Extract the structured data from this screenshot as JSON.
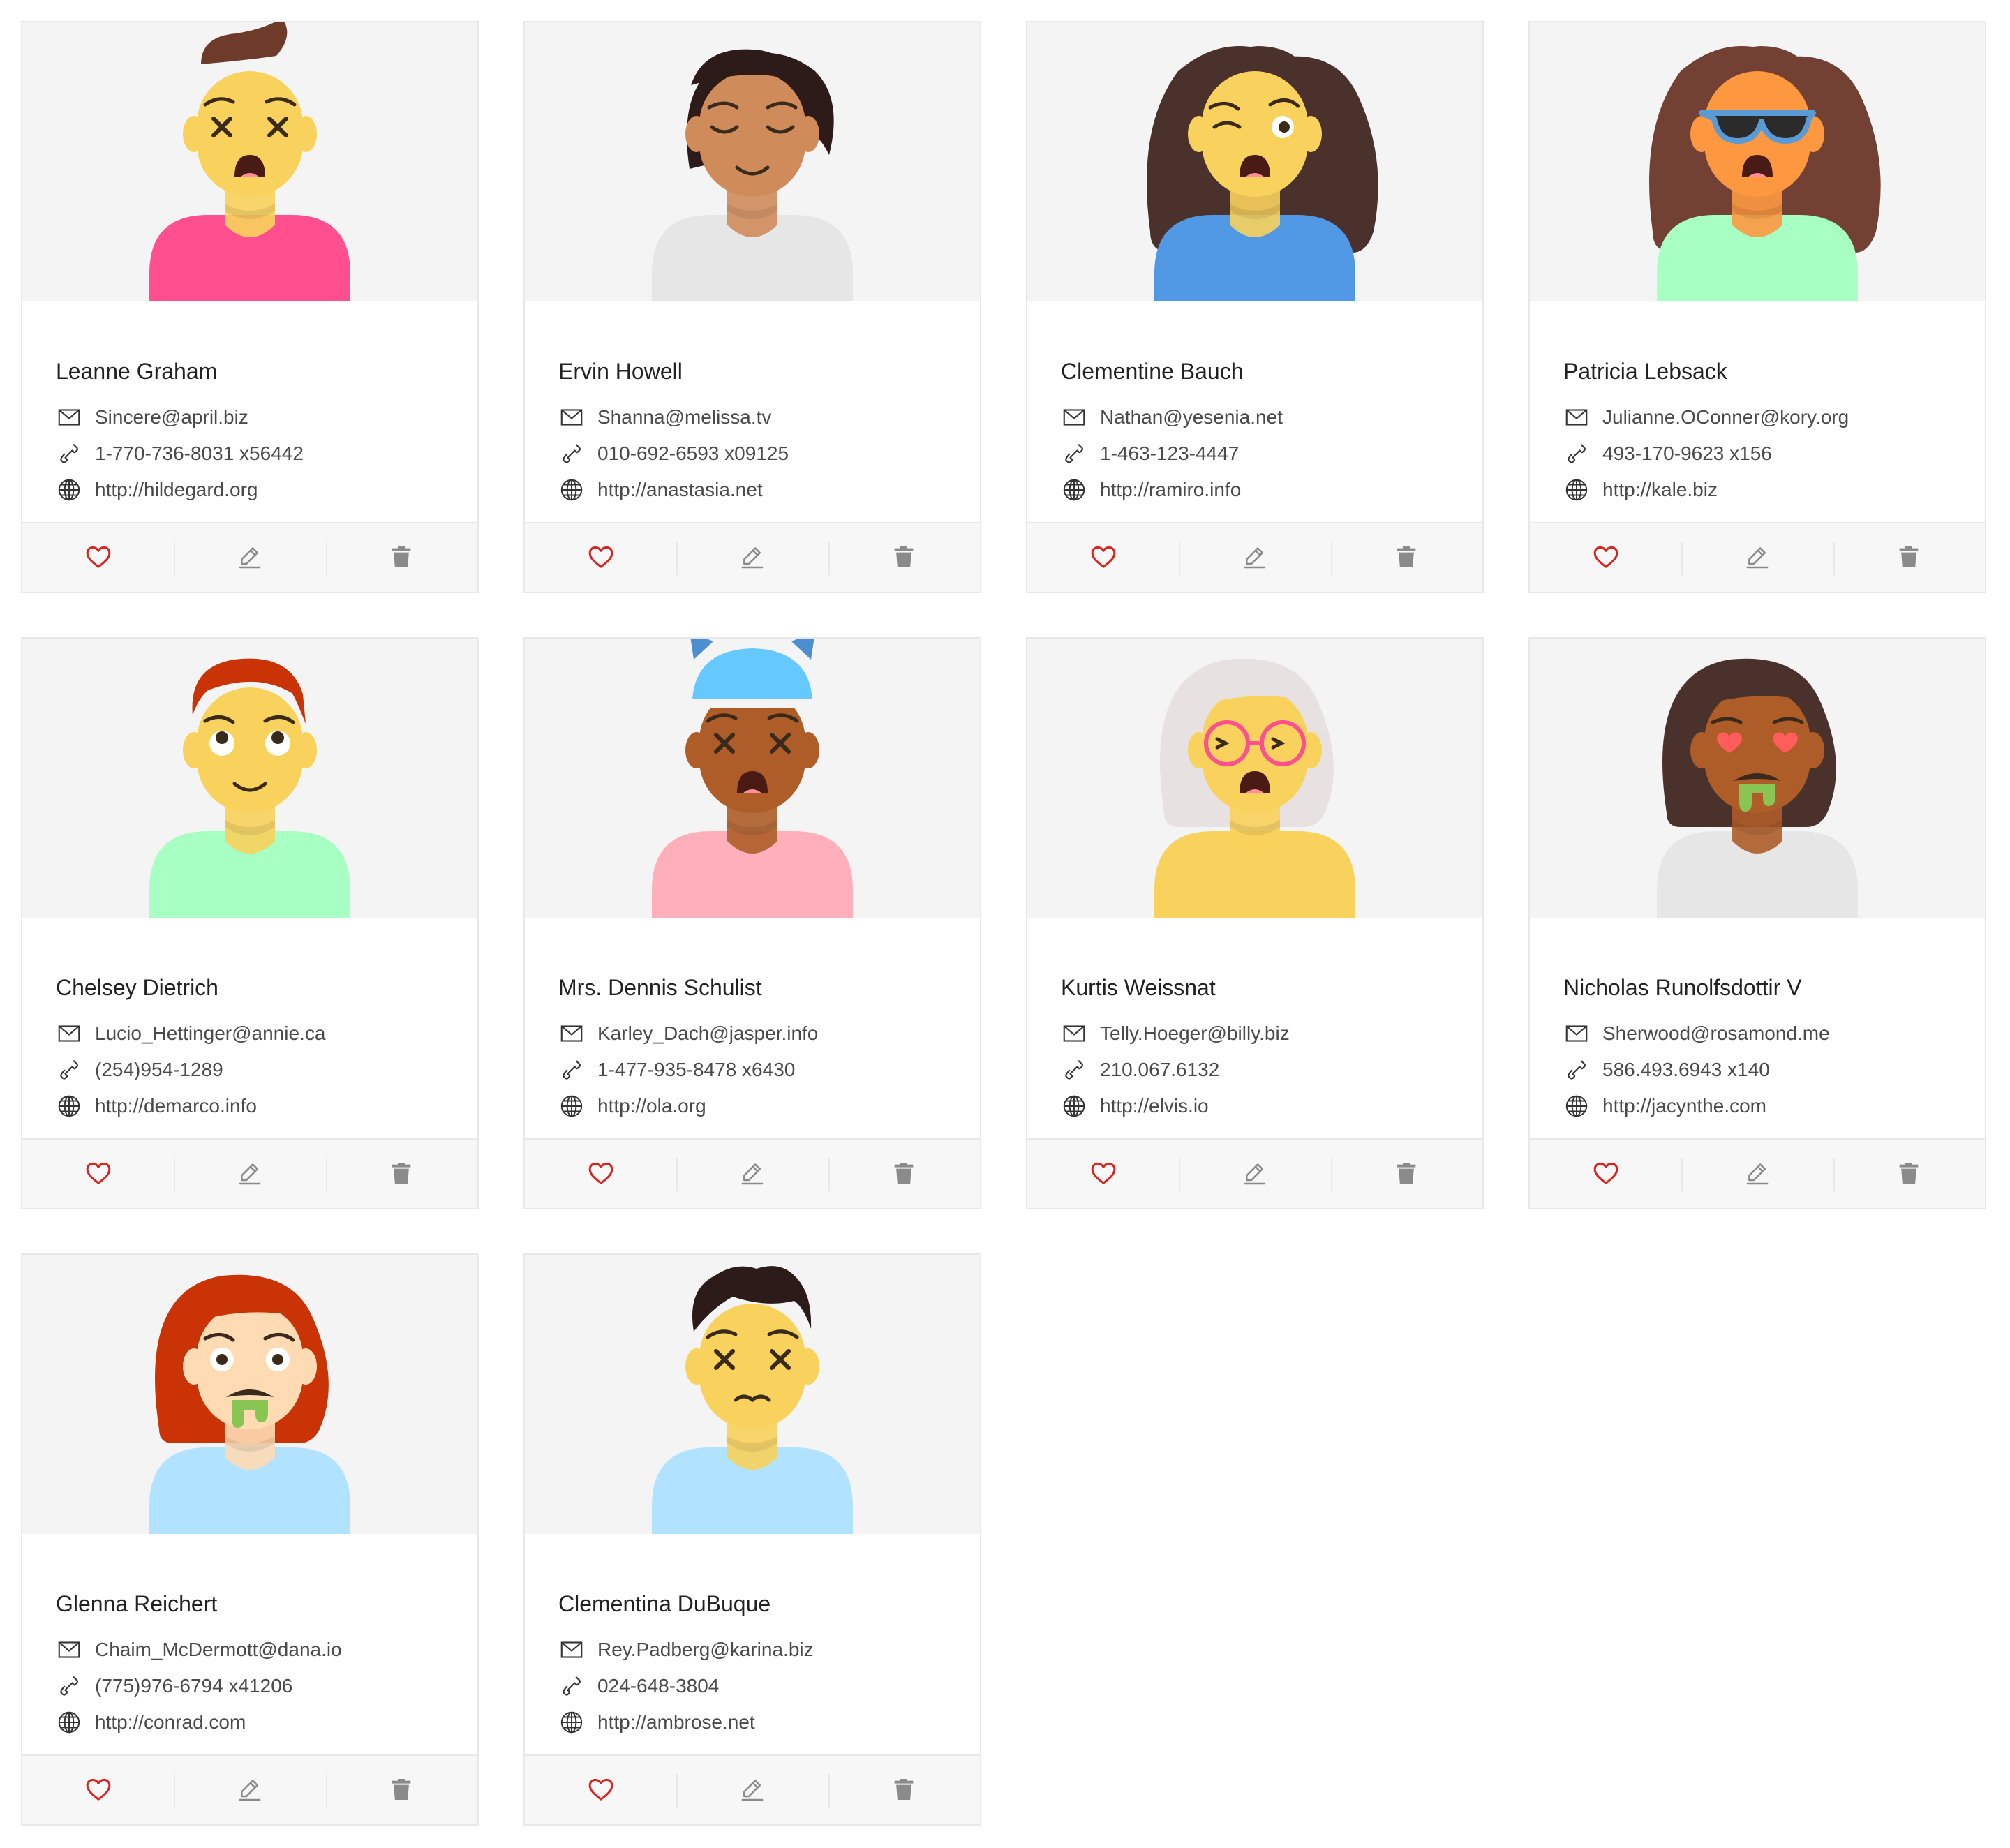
{
  "colors": {
    "heart": "#e0201b",
    "action_icon": "#8a8a8a",
    "text": "#4a4a4a",
    "avatar_bg": "#f4f4f4"
  },
  "icons": {
    "email": "mail-icon",
    "phone": "phone-icon",
    "website": "globe-icon",
    "like": "heart-icon",
    "edit": "pencil-icon",
    "delete": "trash-icon"
  },
  "users": [
    {
      "name": "Leanne Graham",
      "email": "Sincere@april.biz",
      "phone": "1-770-736-8031 x56442",
      "website": "http://hildegard.org",
      "avatar": {
        "skin": "#f8d25c",
        "hair": "#6e3b2b",
        "hair_style": "quiff",
        "shirt": "#ff4f8f",
        "eyes": "crossed",
        "mouth": "open"
      }
    },
    {
      "name": "Ervin Howell",
      "email": "Shanna@melissa.tv",
      "phone": "010-692-6593 x09125",
      "website": "http://anastasia.net",
      "avatar": {
        "skin": "#d08b5b",
        "hair": "#2c1b18",
        "hair_style": "bob",
        "shirt": "#e6e6e6",
        "eyes": "closed",
        "mouth": "smile"
      }
    },
    {
      "name": "Clementine Bauch",
      "email": "Nathan@yesenia.net",
      "phone": "1-463-123-4447",
      "website": "http://ramiro.info",
      "avatar": {
        "skin": "#f8d25c",
        "hair": "#4a312c",
        "hair_style": "long",
        "shirt": "#5199e4",
        "eyes": "wink",
        "mouth": "open"
      }
    },
    {
      "name": "Patricia Lebsack",
      "email": "Julianne.OConner@kory.org",
      "phone": "493-170-9623 x156",
      "website": "http://kale.biz",
      "avatar": {
        "skin": "#fd9841",
        "hair": "#724133",
        "hair_style": "long",
        "shirt": "#a7ffc4",
        "eyes": "sunglasses",
        "mouth": "open"
      }
    },
    {
      "name": "Chelsey Dietrich",
      "email": "Lucio_Hettinger@annie.ca",
      "phone": "(254)954-1289",
      "website": "http://demarco.info",
      "avatar": {
        "skin": "#f8d25c",
        "hair": "#c93305",
        "hair_style": "short",
        "shirt": "#a7ffc4",
        "eyes": "roll",
        "mouth": "smile"
      }
    },
    {
      "name": "Mrs. Dennis Schulist",
      "email": "Karley_Dach@jasper.info",
      "phone": "1-477-935-8478 x6430",
      "website": "http://ola.org",
      "avatar": {
        "skin": "#ae5d29",
        "hair": "#65c9ff",
        "hair_style": "cathat",
        "shirt": "#ffafb9",
        "eyes": "crossed",
        "mouth": "open"
      }
    },
    {
      "name": "Kurtis Weissnat",
      "email": "Telly.Hoeger@billy.biz",
      "phone": "210.067.6132",
      "website": "http://elvis.io",
      "avatar": {
        "skin": "#f8d25c",
        "hair": "#e8e1e1",
        "hair_style": "bob-long",
        "shirt": "#f8d25c",
        "eyes": "squint-glasses",
        "mouth": "open"
      }
    },
    {
      "name": "Nicholas Runolfsdottir V",
      "email": "Sherwood@rosamond.me",
      "phone": "586.493.6943 x140",
      "website": "http://jacynthe.com",
      "avatar": {
        "skin": "#ae5d29",
        "hair": "#4a312c",
        "hair_style": "bob-long",
        "shirt": "#e6e6e6",
        "eyes": "hearts",
        "mouth": "vomit"
      }
    },
    {
      "name": "Glenna Reichert",
      "email": "Chaim_McDermott@dana.io",
      "phone": "(775)976-6794 x41206",
      "website": "http://conrad.com",
      "avatar": {
        "skin": "#ffdbb4",
        "hair": "#c93305",
        "hair_style": "bob-long",
        "shirt": "#b1e2ff",
        "eyes": "round",
        "mouth": "vomit"
      }
    },
    {
      "name": "Clementina DuBuque",
      "email": "Rey.Padberg@karina.biz",
      "phone": "024-648-3804",
      "website": "http://ambrose.net",
      "avatar": {
        "skin": "#f8d25c",
        "hair": "#2c1b18",
        "hair_style": "curly-short",
        "shirt": "#b1e2ff",
        "eyes": "crossed",
        "mouth": "puff"
      }
    }
  ]
}
